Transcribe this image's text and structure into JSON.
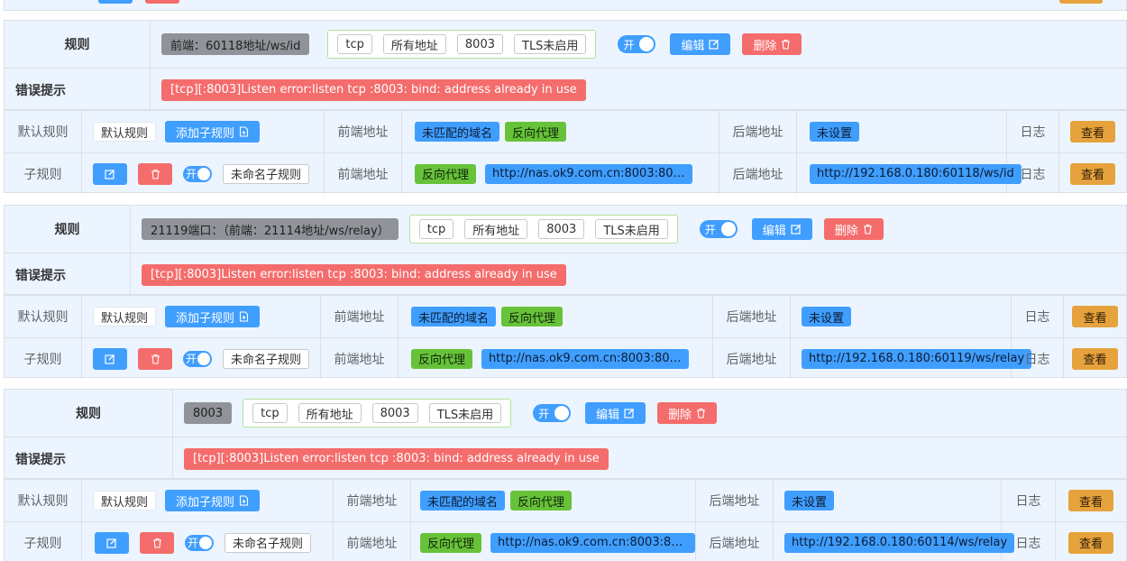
{
  "colors": {
    "primary": "#409eff",
    "success": "#67c23a",
    "danger": "#f56c6c",
    "warning": "#e6a23c",
    "info": "#909399",
    "row_bg": "#ecf5ff"
  },
  "labels": {
    "rule": "规则",
    "error": "错误提示",
    "default_rule": "默认规则",
    "sub_rule": "子规则",
    "front_addr": "前端地址",
    "back_addr": "后端地址",
    "log": "日志",
    "view": "查看",
    "edit": "编辑",
    "delete": "删除",
    "switch_on": "开",
    "add_sub_rule": "添加子规则",
    "unmatched_domain": "未匹配的域名",
    "reverse_proxy": "反向代理",
    "not_set": "未设置",
    "unnamed_sub_rule": "未命名子规则"
  },
  "rules": [
    {
      "name": "前端：60118地址/ws/id",
      "protocol": "tcp",
      "address": "所有地址",
      "port": "8003",
      "tls": "TLS未启用",
      "error": "[tcp][:8003]Listen error:listen tcp :8003: bind: address already in use",
      "sub_front": "http://nas.ok9.com.cn:8003:8003/ws/i...",
      "sub_back": "http://192.168.0.180:60118/ws/id"
    },
    {
      "name": "21119端口：（前端：21114地址/ws/relay）",
      "protocol": "tcp",
      "address": "所有地址",
      "port": "8003",
      "tls": "TLS未启用",
      "error": "[tcp][:8003]Listen error:listen tcp :8003: bind: address already in use",
      "sub_front": "http://nas.ok9.com.cn:8003:8003/ws/r...",
      "sub_back": "http://192.168.0.180:60119/ws/relay"
    },
    {
      "name": "8003",
      "protocol": "tcp",
      "address": "所有地址",
      "port": "8003",
      "tls": "TLS未启用",
      "error": "[tcp][:8003]Listen error:listen tcp :8003: bind: address already in use",
      "sub_front": "http://nas.ok9.com.cn:8003:8003",
      "sub_back": "http://192.168.0.180:60114/ws/relay"
    }
  ]
}
